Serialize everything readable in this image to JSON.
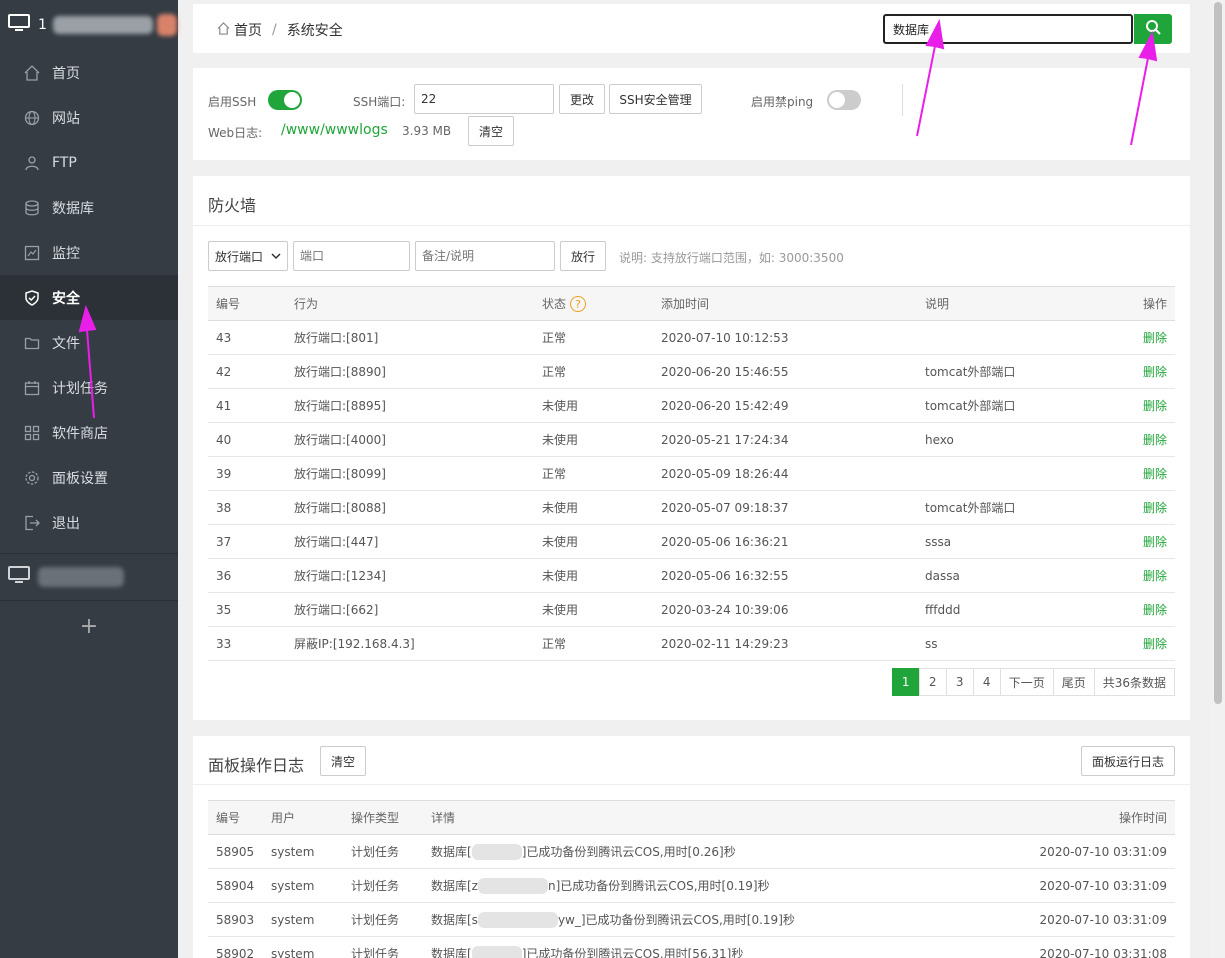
{
  "sidebar": {
    "server_name": "1",
    "items": [
      {
        "label": "首页",
        "icon": "home-icon"
      },
      {
        "label": "网站",
        "icon": "globe-icon"
      },
      {
        "label": "FTP",
        "icon": "ftp-icon"
      },
      {
        "label": "数据库",
        "icon": "database-icon"
      },
      {
        "label": "监控",
        "icon": "monitor-icon"
      },
      {
        "label": "安全",
        "icon": "shield-icon"
      },
      {
        "label": "文件",
        "icon": "folder-icon"
      },
      {
        "label": "计划任务",
        "icon": "calendar-icon"
      },
      {
        "label": "软件商店",
        "icon": "apps-icon"
      },
      {
        "label": "面板设置",
        "icon": "gear-icon"
      },
      {
        "label": "退出",
        "icon": "logout-icon"
      }
    ],
    "add_label": "+"
  },
  "breadcrumb": {
    "home": "首页",
    "separator": "/",
    "current": "系统安全"
  },
  "search": {
    "value": "数据库"
  },
  "settings": {
    "ssh_enable_label": "启用SSH",
    "ssh_enabled": true,
    "ssh_port_label": "SSH端口:",
    "ssh_port_value": "22",
    "change_label": "更改",
    "ssh_manage_label": "SSH安全管理",
    "ping_label": "启用禁ping",
    "ping_enabled": false,
    "weblog_label": "Web日志:",
    "weblog_path": "/www/wwwlogs",
    "weblog_size": "3.93 MB",
    "clear_label": "清空"
  },
  "firewall": {
    "title": "防火墙",
    "select_value": "放行端口",
    "port_placeholder": "端口",
    "note_placeholder": "备注/说明",
    "allow_label": "放行",
    "hint": "说明: 支持放行端口范围，如: 3000:3500",
    "columns": [
      "编号",
      "行为",
      "状态",
      "添加时间",
      "说明",
      "操作"
    ],
    "rows": [
      {
        "id": "43",
        "action": "放行端口:[801]",
        "status": "正常",
        "time": "2020-07-10 10:12:53",
        "note": "",
        "op": "删除"
      },
      {
        "id": "42",
        "action": "放行端口:[8890]",
        "status": "正常",
        "time": "2020-06-20 15:46:55",
        "note": "tomcat外部端口",
        "op": "删除"
      },
      {
        "id": "41",
        "action": "放行端口:[8895]",
        "status": "未使用",
        "time": "2020-06-20 15:42:49",
        "note": "tomcat外部端口",
        "op": "删除"
      },
      {
        "id": "40",
        "action": "放行端口:[4000]",
        "status": "未使用",
        "time": "2020-05-21 17:24:34",
        "note": "hexo",
        "op": "删除"
      },
      {
        "id": "39",
        "action": "放行端口:[8099]",
        "status": "正常",
        "time": "2020-05-09 18:26:44",
        "note": "",
        "op": "删除"
      },
      {
        "id": "38",
        "action": "放行端口:[8088]",
        "status": "未使用",
        "time": "2020-05-07 09:18:37",
        "note": "tomcat外部端口",
        "op": "删除"
      },
      {
        "id": "37",
        "action": "放行端口:[447]",
        "status": "未使用",
        "time": "2020-05-06 16:36:21",
        "note": "sssa",
        "op": "删除"
      },
      {
        "id": "36",
        "action": "放行端口:[1234]",
        "status": "未使用",
        "time": "2020-05-06 16:32:55",
        "note": "dassa",
        "op": "删除"
      },
      {
        "id": "35",
        "action": "放行端口:[662]",
        "status": "未使用",
        "time": "2020-03-24 10:39:06",
        "note": "fffddd",
        "op": "删除"
      },
      {
        "id": "33",
        "action": "屏蔽IP:[192.168.4.3]",
        "status": "正常",
        "time": "2020-02-11 14:29:23",
        "note": "ss",
        "op": "删除"
      }
    ],
    "pager": {
      "pages": [
        "1",
        "2",
        "3",
        "4"
      ],
      "current": "1",
      "next": "下一页",
      "last": "尾页",
      "total": "共36条数据"
    }
  },
  "logs": {
    "title": "面板操作日志",
    "clear_label": "清空",
    "runlog_label": "面板运行日志",
    "columns": [
      "编号",
      "用户",
      "操作类型",
      "详情",
      "操作时间"
    ],
    "rows": [
      {
        "id": "58905",
        "user": "system",
        "type": "计划任务",
        "detail_pre": "数据库[",
        "detail_post": "]已成功备份到腾讯云COS,用时[0.26]秒",
        "time": "2020-07-10 03:31:09"
      },
      {
        "id": "58904",
        "user": "system",
        "type": "计划任务",
        "detail_pre": "数据库[z",
        "detail_post": "n]已成功备份到腾讯云COS,用时[0.19]秒",
        "time": "2020-07-10 03:31:09"
      },
      {
        "id": "58903",
        "user": "system",
        "type": "计划任务",
        "detail_pre": "数据库[s",
        "detail_post": "yw_]已成功备份到腾讯云COS,用时[0.19]秒",
        "time": "2020-07-10 03:31:09"
      },
      {
        "id": "58902",
        "user": "system",
        "type": "计划任务",
        "detail_pre": "数据库[",
        "detail_post": "]已成功备份到腾讯云COS,用时[56.31]秒",
        "time": "2020-07-10 03:31:08"
      }
    ]
  },
  "colors": {
    "brand": "#20a53a",
    "sidebar": "#353c44",
    "annotation": "#e91ee9"
  }
}
